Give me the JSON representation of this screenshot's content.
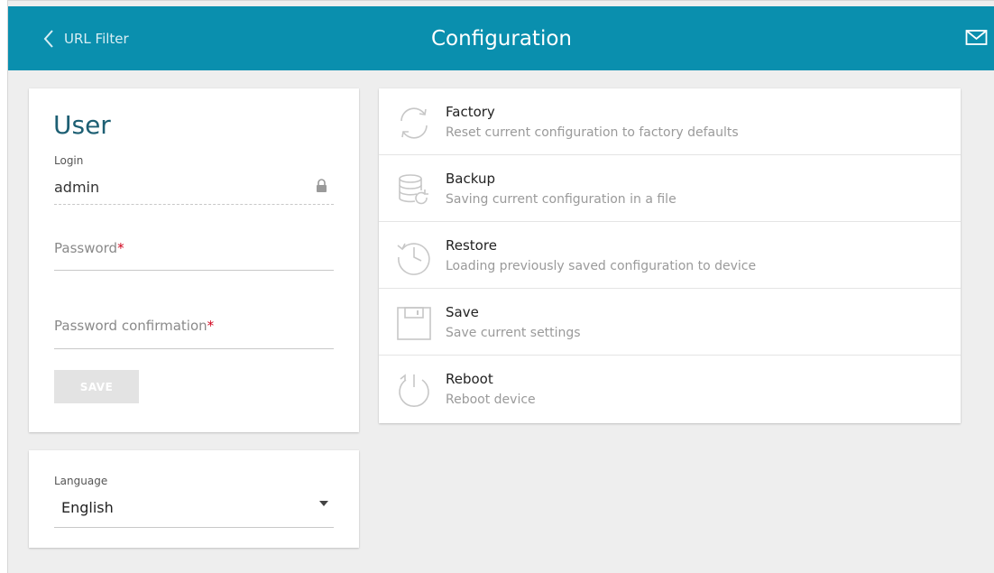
{
  "header": {
    "back_label": "URL Filter",
    "title": "Configuration"
  },
  "user": {
    "title": "User",
    "login_label": "Login",
    "login_value": "admin",
    "password_label": "Password",
    "password_confirm_label": "Password confirmation",
    "required_mark": "*",
    "save_label": "SAVE"
  },
  "language": {
    "label": "Language",
    "selected": "English"
  },
  "config_items": [
    {
      "name": "Factory",
      "description": "Reset current configuration to factory defaults",
      "icon": "refresh-icon"
    },
    {
      "name": "Backup",
      "description": "Saving current configuration in a file",
      "icon": "database-icon"
    },
    {
      "name": "Restore",
      "description": "Loading previously saved configuration to device",
      "icon": "history-icon"
    },
    {
      "name": "Save",
      "description": "Save current settings",
      "icon": "floppy-icon"
    },
    {
      "name": "Reboot",
      "description": "Reboot device",
      "icon": "power-icon"
    }
  ],
  "colors": {
    "header": "#0a8fae",
    "title_text": "#1d5f73",
    "background": "#eeeeee",
    "required": "#d0021b"
  }
}
